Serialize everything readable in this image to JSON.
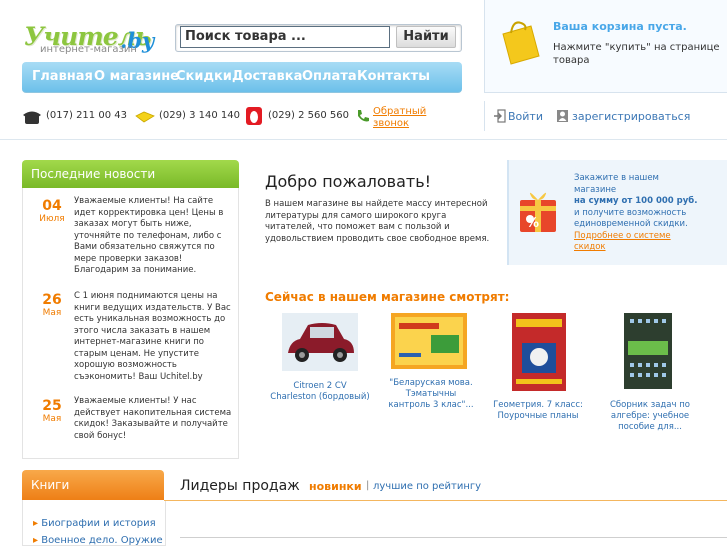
{
  "header": {
    "logo_main": "Учитель",
    "logo_domain": ".by",
    "logo_sub": "интернет-магазин",
    "search_placeholder": "Поиск товара ...",
    "search_button": "Найти"
  },
  "nav": [
    "Главная",
    "О магазине",
    "Скидки",
    "Доставка",
    "Оплата",
    "Контакты"
  ],
  "cart": {
    "title": "Ваша корзина пуста.",
    "text": "Нажмите \"купить\" на странице товара"
  },
  "contacts": {
    "phone1": "(017) 211 00 43",
    "phone2": "(029) 3 140 140",
    "phone3": "(029) 2 560 560",
    "callback": "Обратный звонок",
    "login": "Войти",
    "register": "зарегистрироваться"
  },
  "news": {
    "title": "Последние новости",
    "items": [
      {
        "day": "04",
        "month": "Июля",
        "text": "Уважаемые клиенты! На сайте идет корректировка цен! Цены в заказах могут быть ниже, уточняйте по телефонам, либо с Вами обязательно свяжутся по мере проверки заказов! Благодарим за понимание."
      },
      {
        "day": "26",
        "month": "Мая",
        "text": "С 1 июня поднимаются цены на книги ведущих издательств. У Вас есть уникальная возможность до этого числа заказать в нашем интернет-магазине книги по старым ценам. Не упустите хорошую возможность съэкономить! Ваш Uchitel.by"
      },
      {
        "day": "25",
        "month": "Мая",
        "text": "Уважаемые клиенты! У нас действует накопительная система скидок! Заказывайте и получайте свой бонус!"
      }
    ]
  },
  "welcome": {
    "title": "Добро пожаловать!",
    "text": "В нашем магазине вы найдете массу интересной литературы для самого широкого круга читателей, что поможет вам с пользой и удовольствием проводить свое свободное время."
  },
  "promo": {
    "line1": "Закажите в нашем магазине",
    "line2": "на сумму от 100 000 руб.",
    "line3": "и получите возможность единовременной скидки.",
    "link": "Подробнее о системе скидок"
  },
  "watching": {
    "title": "Сейчас в нашем магазине смотрят:",
    "items": [
      {
        "caption": "Citroen 2 CV Charleston (бордовый)"
      },
      {
        "caption": "\"Беларуская мова. Тэматычны кантроль 3 клас\"..."
      },
      {
        "caption": "Геометрия. 7 класс: Поурочные планы"
      },
      {
        "caption": "Сборник задач по алгебре: учебное пособие для..."
      }
    ]
  },
  "books": {
    "title": "Книги",
    "categories": [
      "Биографии и история",
      "Военное дело. Оружие"
    ]
  },
  "leaders": {
    "title": "Лидеры продаж",
    "new": "новинки",
    "sep": "|",
    "top": "лучшие по рейтингу"
  }
}
